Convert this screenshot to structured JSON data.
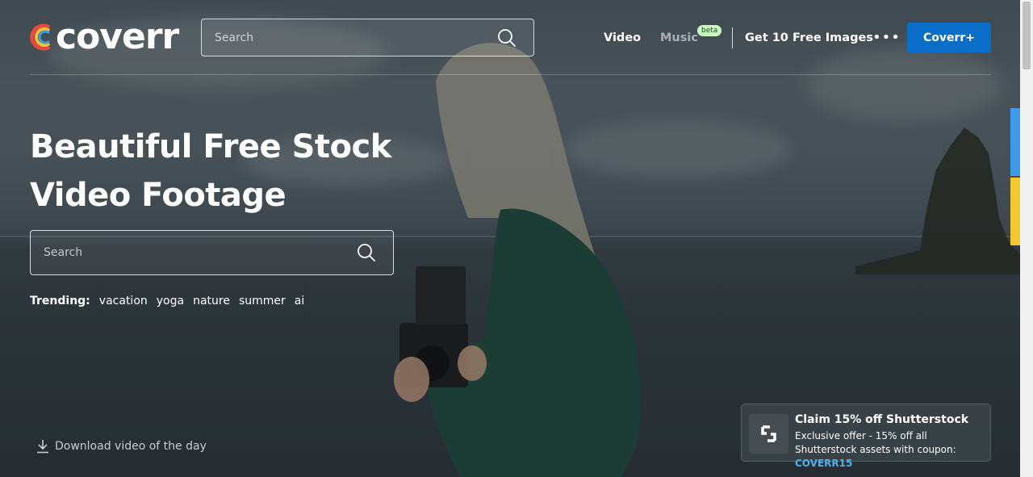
{
  "header": {
    "logo_text": "coverr",
    "search_placeholder": "Search",
    "nav": {
      "video": "Video",
      "music": "Music",
      "music_badge": "beta",
      "free_images": "Get 10 Free Images",
      "more": "•••",
      "cta": "Coverr+"
    }
  },
  "hero": {
    "title_line1": "Beautiful Free Stock",
    "title_line2": "Video Footage",
    "search_placeholder": "Search",
    "trending_label": "Trending:",
    "trending_tags": [
      "vacation",
      "yoga",
      "nature",
      "summer",
      "ai"
    ]
  },
  "download": {
    "label": "Download video of the day",
    "icon": "download-icon"
  },
  "promo": {
    "title": "Claim 15% off Shutterstock",
    "body": "Exclusive offer - 15% off all Shutterstock assets with coupon:",
    "coupon": "COVERR15",
    "icon": "shutterstock-icon"
  },
  "colors": {
    "cta_blue": "#0a6ec9",
    "coupon_blue": "#4fb1ea",
    "beta_green": "#c9f7c2",
    "side_blue": "#3d9be9",
    "side_yellow": "#f4c72f"
  }
}
